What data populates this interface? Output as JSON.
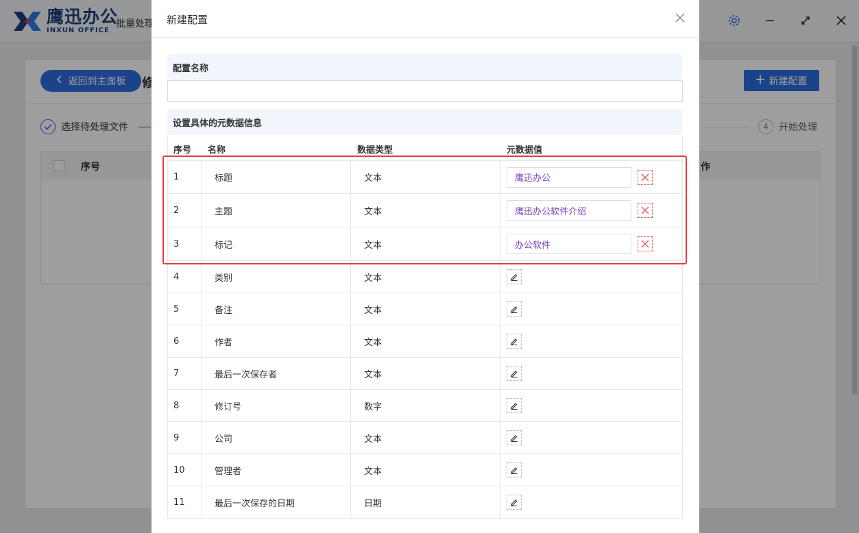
{
  "app": {
    "logo_cn": "鹰迅办公",
    "logo_en": "INXUN OFFICE",
    "title": "批量处理",
    "back_label": "返回到主面板",
    "page_heading": "修",
    "new_config_label": "新建配置",
    "step1_label": "选择待处理文件",
    "step4_num": "4",
    "step4_label": "开始处理",
    "bg_table": {
      "col1": "序号",
      "col_right": "作"
    }
  },
  "modal": {
    "title": "新建配置",
    "close_icon": "close-icon",
    "config_name_label": "配置名称",
    "config_name_value": "",
    "meta_section_label": "设置具体的元数据信息",
    "columns": [
      "序号",
      "名称",
      "数据类型",
      "元数据值"
    ],
    "rows": [
      {
        "idx": "1",
        "name": "标题",
        "type": "文本",
        "value": "鹰迅办公"
      },
      {
        "idx": "2",
        "name": "主题",
        "type": "文本",
        "value": "鹰迅办公软件介绍"
      },
      {
        "idx": "3",
        "name": "标记",
        "type": "文本",
        "value": "办公软件"
      },
      {
        "idx": "4",
        "name": "类别",
        "type": "文本",
        "value": null
      },
      {
        "idx": "5",
        "name": "备注",
        "type": "文本",
        "value": null
      },
      {
        "idx": "6",
        "name": "作者",
        "type": "文本",
        "value": null
      },
      {
        "idx": "7",
        "name": "最后一次保存者",
        "type": "文本",
        "value": null
      },
      {
        "idx": "8",
        "name": "修订号",
        "type": "数字",
        "value": null
      },
      {
        "idx": "9",
        "name": "公司",
        "type": "文本",
        "value": null
      },
      {
        "idx": "10",
        "name": "管理者",
        "type": "文本",
        "value": null
      },
      {
        "idx": "11",
        "name": "最后一次保存的日期",
        "type": "日期",
        "value": null
      }
    ]
  },
  "colors": {
    "accent": "#2d6cdf",
    "value_text": "#7b3fbf",
    "delete": "#e85a5a",
    "highlight_box": "#e63a3a"
  }
}
